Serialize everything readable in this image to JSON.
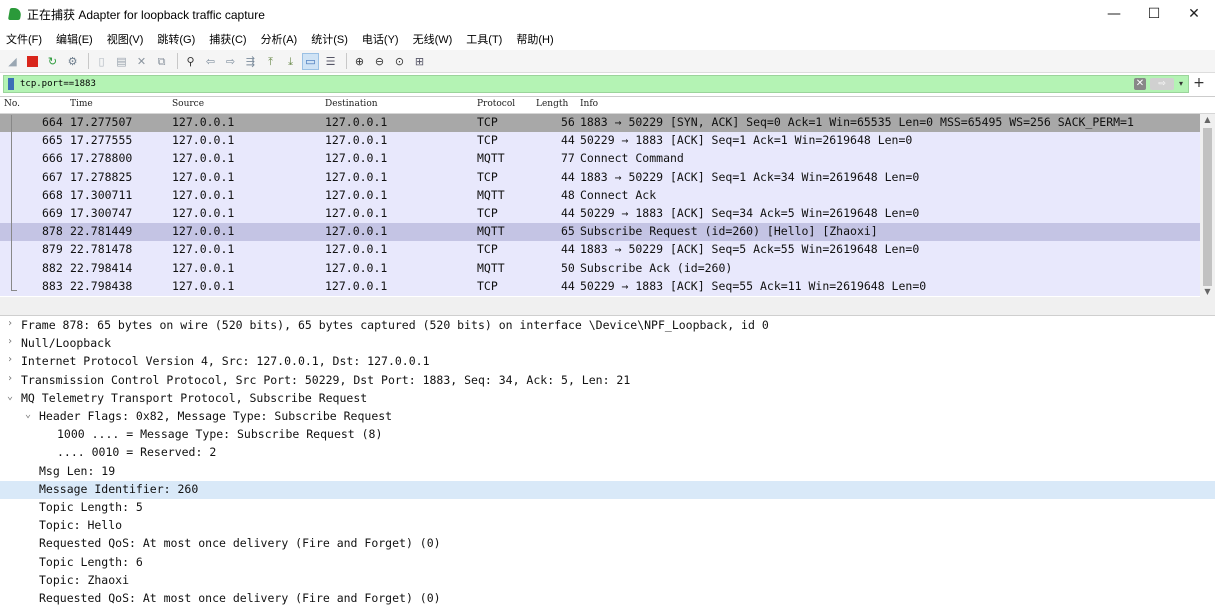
{
  "window": {
    "title": "正在捕获 Adapter for loopback traffic capture",
    "minimize": "—",
    "maximize": "☐",
    "close": "✕"
  },
  "menu": [
    "文件(F)",
    "编辑(E)",
    "视图(V)",
    "跳转(G)",
    "捕获(C)",
    "分析(A)",
    "统计(S)",
    "电话(Y)",
    "无线(W)",
    "工具(T)",
    "帮助(H)"
  ],
  "toolbar_icons": [
    "shark-fin-icon",
    "stop-icon",
    "restart-icon",
    "options-icon",
    "open-icon",
    "save-icon",
    "close-file-icon",
    "reload-icon",
    "find-icon",
    "back-icon",
    "forward-icon",
    "goto-icon",
    "first-icon",
    "last-icon",
    "autoscroll-icon",
    "colorize-icon",
    "zoom-in-icon",
    "zoom-out-icon",
    "zoom-normal-icon",
    "resize-columns-icon"
  ],
  "filter": {
    "value": "tcp.port==1883",
    "clear_icon": "✕",
    "apply_icon": "⇨",
    "dropdown_icon": "▾",
    "add_icon": "+"
  },
  "packet_list": {
    "columns": [
      "No.",
      "Time",
      "Source",
      "Destination",
      "Protocol",
      "Length",
      "Info"
    ],
    "rows": [
      {
        "no": "664",
        "time": "17.277507",
        "src": "127.0.0.1",
        "dst": "127.0.0.1",
        "proto": "TCP",
        "len": "56",
        "info": "1883 → 50229 [SYN, ACK] Seq=0 Ack=1 Win=65535 Len=0 MSS=65495 WS=256 SACK_PERM=1"
      },
      {
        "no": "665",
        "time": "17.277555",
        "src": "127.0.0.1",
        "dst": "127.0.0.1",
        "proto": "TCP",
        "len": "44",
        "info": "50229 → 1883 [ACK] Seq=1 Ack=1 Win=2619648 Len=0"
      },
      {
        "no": "666",
        "time": "17.278800",
        "src": "127.0.0.1",
        "dst": "127.0.0.1",
        "proto": "MQTT",
        "len": "77",
        "info": "Connect Command"
      },
      {
        "no": "667",
        "time": "17.278825",
        "src": "127.0.0.1",
        "dst": "127.0.0.1",
        "proto": "TCP",
        "len": "44",
        "info": "1883 → 50229 [ACK] Seq=1 Ack=34 Win=2619648 Len=0"
      },
      {
        "no": "668",
        "time": "17.300711",
        "src": "127.0.0.1",
        "dst": "127.0.0.1",
        "proto": "MQTT",
        "len": "48",
        "info": "Connect Ack"
      },
      {
        "no": "669",
        "time": "17.300747",
        "src": "127.0.0.1",
        "dst": "127.0.0.1",
        "proto": "TCP",
        "len": "44",
        "info": "50229 → 1883 [ACK] Seq=34 Ack=5 Win=2619648 Len=0"
      },
      {
        "no": "878",
        "time": "22.781449",
        "src": "127.0.0.1",
        "dst": "127.0.0.1",
        "proto": "MQTT",
        "len": "65",
        "info": "Subscribe Request (id=260) [Hello] [Zhaoxi]"
      },
      {
        "no": "879",
        "time": "22.781478",
        "src": "127.0.0.1",
        "dst": "127.0.0.1",
        "proto": "TCP",
        "len": "44",
        "info": "1883 → 50229 [ACK] Seq=5 Ack=55 Win=2619648 Len=0"
      },
      {
        "no": "882",
        "time": "22.798414",
        "src": "127.0.0.1",
        "dst": "127.0.0.1",
        "proto": "MQTT",
        "len": "50",
        "info": "Subscribe Ack (id=260)"
      },
      {
        "no": "883",
        "time": "22.798438",
        "src": "127.0.0.1",
        "dst": "127.0.0.1",
        "proto": "TCP",
        "len": "44",
        "info": "50229 → 1883 [ACK] Seq=55 Ack=11 Win=2619648 Len=0"
      }
    ]
  },
  "details": [
    {
      "arrow": "›",
      "text": "Frame 878: 65 bytes on wire (520 bits), 65 bytes captured (520 bits) on interface \\Device\\NPF_Loopback, id 0"
    },
    {
      "arrow": "›",
      "text": "Null/Loopback"
    },
    {
      "arrow": "›",
      "text": "Internet Protocol Version 4, Src: 127.0.0.1, Dst: 127.0.0.1"
    },
    {
      "arrow": "›",
      "text": "Transmission Control Protocol, Src Port: 50229, Dst Port: 1883, Seq: 34, Ack: 5, Len: 21"
    },
    {
      "arrow": "⌄",
      "text": "MQ Telemetry Transport Protocol, Subscribe Request"
    },
    {
      "arrow": "⌄",
      "text": "Header Flags: 0x82, Message Type: Subscribe Request"
    },
    {
      "arrow": "",
      "text": "1000 .... = Message Type: Subscribe Request (8)"
    },
    {
      "arrow": "",
      "text": ".... 0010 = Reserved: 2"
    },
    {
      "arrow": "",
      "text": "Msg Len: 19"
    },
    {
      "arrow": "",
      "text": "Message Identifier: 260"
    },
    {
      "arrow": "",
      "text": "Topic Length: 5"
    },
    {
      "arrow": "",
      "text": "Topic: Hello"
    },
    {
      "arrow": "",
      "text": "Requested QoS: At most once delivery (Fire and Forget) (0)"
    },
    {
      "arrow": "",
      "text": "Topic Length: 6"
    },
    {
      "arrow": "",
      "text": "Topic: Zhaoxi"
    },
    {
      "arrow": "",
      "text": "Requested QoS: At most once delivery (Fire and Forget) (0)"
    }
  ]
}
